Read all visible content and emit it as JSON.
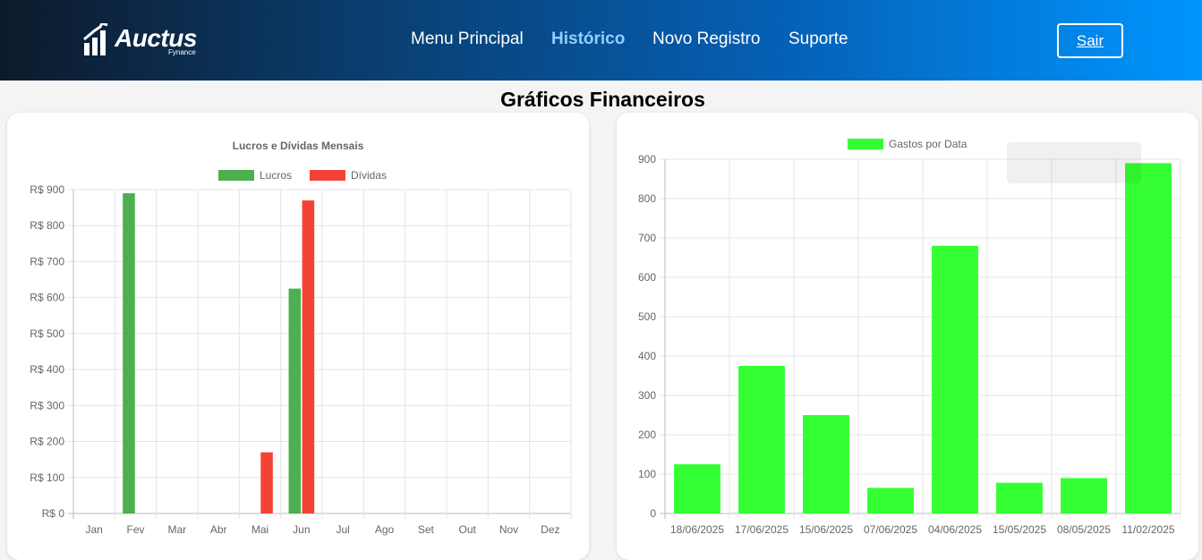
{
  "header": {
    "logo_text": "Auctus",
    "logo_subtext": "Fynance",
    "nav": [
      {
        "label": "Menu Principal",
        "active": false
      },
      {
        "label": "Histórico",
        "active": true
      },
      {
        "label": "Novo Registro",
        "active": false
      },
      {
        "label": "Suporte",
        "active": false
      }
    ],
    "logout_label": "Sair"
  },
  "page": {
    "title": "Gráficos Financeiros"
  },
  "chart_data": [
    {
      "type": "bar",
      "title": "Lucros e Dívidas Mensais",
      "categories": [
        "Jan",
        "Fev",
        "Mar",
        "Abr",
        "Mai",
        "Jun",
        "Jul",
        "Ago",
        "Set",
        "Out",
        "Nov",
        "Dez"
      ],
      "series": [
        {
          "name": "Lucros",
          "color": "#4caf50",
          "values": [
            0,
            890,
            0,
            0,
            0,
            625,
            0,
            0,
            0,
            0,
            0,
            0
          ]
        },
        {
          "name": "Dívidas",
          "color": "#f44336",
          "values": [
            0,
            0,
            0,
            0,
            170,
            870,
            0,
            0,
            0,
            0,
            0,
            0
          ]
        }
      ],
      "ylim": [
        0,
        900
      ],
      "yticks": [
        "R$ 0",
        "R$ 100",
        "R$ 200",
        "R$ 300",
        "R$ 400",
        "R$ 500",
        "R$ 600",
        "R$ 700",
        "R$ 800",
        "R$ 900"
      ],
      "grid": true,
      "legend": "top"
    },
    {
      "type": "bar",
      "categories": [
        "18/06/2025",
        "17/06/2025",
        "15/06/2025",
        "07/06/2025",
        "04/06/2025",
        "15/05/2025",
        "08/05/2025",
        "11/02/2025"
      ],
      "series": [
        {
          "name": "Gastos por Data",
          "color": "#33ff33",
          "values": [
            125,
            375,
            250,
            65,
            680,
            78,
            90,
            890
          ]
        }
      ],
      "ylim": [
        0,
        900
      ],
      "yticks": [
        "0",
        "100",
        "200",
        "300",
        "400",
        "500",
        "600",
        "700",
        "800",
        "900"
      ],
      "grid": true,
      "legend": "top"
    }
  ]
}
